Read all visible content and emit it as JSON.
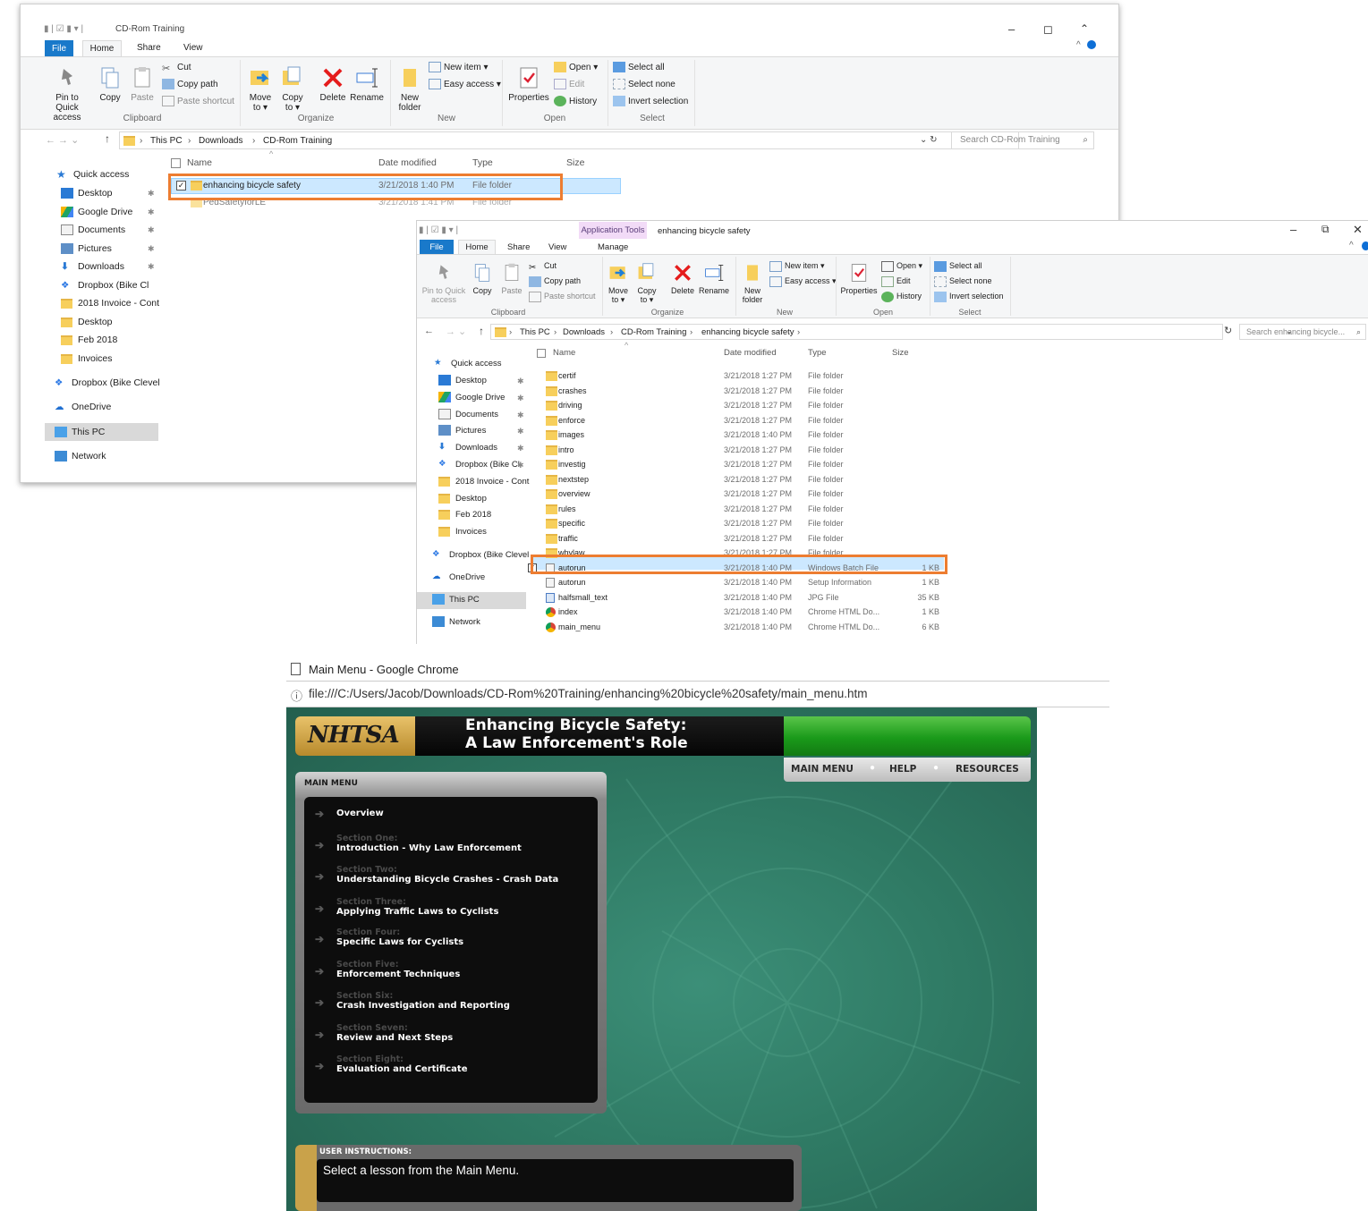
{
  "win1": {
    "title": "CD-Rom Training",
    "tabs": [
      "File",
      "Home",
      "Share",
      "View"
    ],
    "ribbon": {
      "pin": "Pin to Quick access",
      "copy": "Copy",
      "paste": "Paste",
      "cut": "Cut",
      "copy_path": "Copy path",
      "paste_shortcut": "Paste shortcut",
      "move_to": "Move to ▾",
      "copy_to": "Copy to ▾",
      "delete": "Delete",
      "rename": "Rename",
      "new_folder": "New folder",
      "new_item": "New item ▾",
      "easy_access": "Easy access ▾",
      "properties": "Properties",
      "open": "Open ▾",
      "edit": "Edit",
      "history": "History",
      "select_all": "Select all",
      "select_none": "Select none",
      "invert_selection": "Invert selection",
      "groups": [
        "Clipboard",
        "Organize",
        "New",
        "Open",
        "Select"
      ]
    },
    "breadcrumb": [
      "This PC",
      "Downloads",
      "CD-Rom Training"
    ],
    "search_placeholder": "Search CD-Rom Training",
    "nav": [
      "Quick access",
      "Desktop",
      "Google Drive",
      "Documents",
      "Pictures",
      "Downloads",
      "Dropbox (Bike Cl",
      "2018 Invoice - Cont",
      "Desktop",
      "Feb 2018",
      "Invoices",
      "Dropbox (Bike Clevel",
      "OneDrive",
      "This PC",
      "Network"
    ],
    "columns": [
      "Name",
      "Date modified",
      "Type",
      "Size"
    ],
    "files": [
      {
        "name": "enhancing bicycle safety",
        "date": "3/21/2018 1:40 PM",
        "type": "File folder",
        "size": ""
      },
      {
        "name": "PedSafetyforLE",
        "date": "3/21/2018 1:41 PM",
        "type": "File folder",
        "size": ""
      }
    ]
  },
  "win2": {
    "app_tools": "Application Tools",
    "title": "enhancing bicycle safety",
    "tabs": [
      "File",
      "Home",
      "Share",
      "View",
      "Manage"
    ],
    "breadcrumb": [
      "This PC",
      "Downloads",
      "CD-Rom Training",
      "enhancing bicycle safety"
    ],
    "search_placeholder": "Search enhancing bicycle...",
    "nav": [
      "Quick access",
      "Desktop",
      "Google Drive",
      "Documents",
      "Pictures",
      "Downloads",
      "Dropbox (Bike Cl",
      "2018 Invoice - Cont",
      "Desktop",
      "Feb 2018",
      "Invoices",
      "Dropbox (Bike Clevel",
      "OneDrive",
      "This PC",
      "Network"
    ],
    "files": [
      {
        "name": "certif",
        "date": "3/21/2018 1:27 PM",
        "type": "File folder",
        "size": ""
      },
      {
        "name": "crashes",
        "date": "3/21/2018 1:27 PM",
        "type": "File folder",
        "size": ""
      },
      {
        "name": "driving",
        "date": "3/21/2018 1:27 PM",
        "type": "File folder",
        "size": ""
      },
      {
        "name": "enforce",
        "date": "3/21/2018 1:27 PM",
        "type": "File folder",
        "size": ""
      },
      {
        "name": "images",
        "date": "3/21/2018 1:40 PM",
        "type": "File folder",
        "size": ""
      },
      {
        "name": "intro",
        "date": "3/21/2018 1:27 PM",
        "type": "File folder",
        "size": ""
      },
      {
        "name": "investig",
        "date": "3/21/2018 1:27 PM",
        "type": "File folder",
        "size": ""
      },
      {
        "name": "nextstep",
        "date": "3/21/2018 1:27 PM",
        "type": "File folder",
        "size": ""
      },
      {
        "name": "overview",
        "date": "3/21/2018 1:27 PM",
        "type": "File folder",
        "size": ""
      },
      {
        "name": "rules",
        "date": "3/21/2018 1:27 PM",
        "type": "File folder",
        "size": ""
      },
      {
        "name": "specific",
        "date": "3/21/2018 1:27 PM",
        "type": "File folder",
        "size": ""
      },
      {
        "name": "traffic",
        "date": "3/21/2018 1:27 PM",
        "type": "File folder",
        "size": ""
      },
      {
        "name": "whylaw",
        "date": "3/21/2018 1:27 PM",
        "type": "File folder",
        "size": ""
      },
      {
        "name": "autorun",
        "date": "3/21/2018 1:40 PM",
        "type": "Windows Batch File",
        "size": "1 KB"
      },
      {
        "name": "autorun",
        "date": "3/21/2018 1:40 PM",
        "type": "Setup Information",
        "size": "1 KB"
      },
      {
        "name": "halfsmall_text",
        "date": "3/21/2018 1:40 PM",
        "type": "JPG File",
        "size": "35 KB"
      },
      {
        "name": "index",
        "date": "3/21/2018 1:40 PM",
        "type": "Chrome HTML Do...",
        "size": "1 KB"
      },
      {
        "name": "main_menu",
        "date": "3/21/2018 1:40 PM",
        "type": "Chrome HTML Do...",
        "size": "6 KB"
      }
    ]
  },
  "chrome": {
    "title": "Main Menu - Google Chrome",
    "url": "file:///C:/Users/Jacob/Downloads/CD-Rom%20Training/enhancing%20bicycle%20safety/main_menu.htm"
  },
  "nhtsa": {
    "logo": "NHTSA",
    "title1": "Enhancing Bicycle Safety:",
    "title2": "A Law Enforcement's Role",
    "nav": [
      "MAIN MENU",
      "HELP",
      "RESOURCES"
    ],
    "menu_header": "MAIN MENU",
    "overview": "Overview",
    "sections": [
      {
        "sec": "Section One:",
        "title": "Introduction - Why Law Enforcement"
      },
      {
        "sec": "Section Two:",
        "title": "Understanding Bicycle Crashes - Crash Data"
      },
      {
        "sec": "Section Three:",
        "title": "Applying Traffic Laws to Cyclists"
      },
      {
        "sec": "Section Four:",
        "title": "Specific Laws for Cyclists"
      },
      {
        "sec": "Section Five:",
        "title": "Enforcement Techniques"
      },
      {
        "sec": "Section Six:",
        "title": "Crash Investigation and Reporting"
      },
      {
        "sec": "Section Seven:",
        "title": "Review and Next Steps"
      },
      {
        "sec": "Section Eight:",
        "title": "Evaluation and Certificate"
      }
    ],
    "instructions_header": "USER INSTRUCTIONS:",
    "instructions": "Select a lesson from the Main Menu.",
    "colors": {
      "green": "#1a9a1a",
      "panel": "#0d0d0d",
      "accent": "#c9a24a"
    }
  }
}
